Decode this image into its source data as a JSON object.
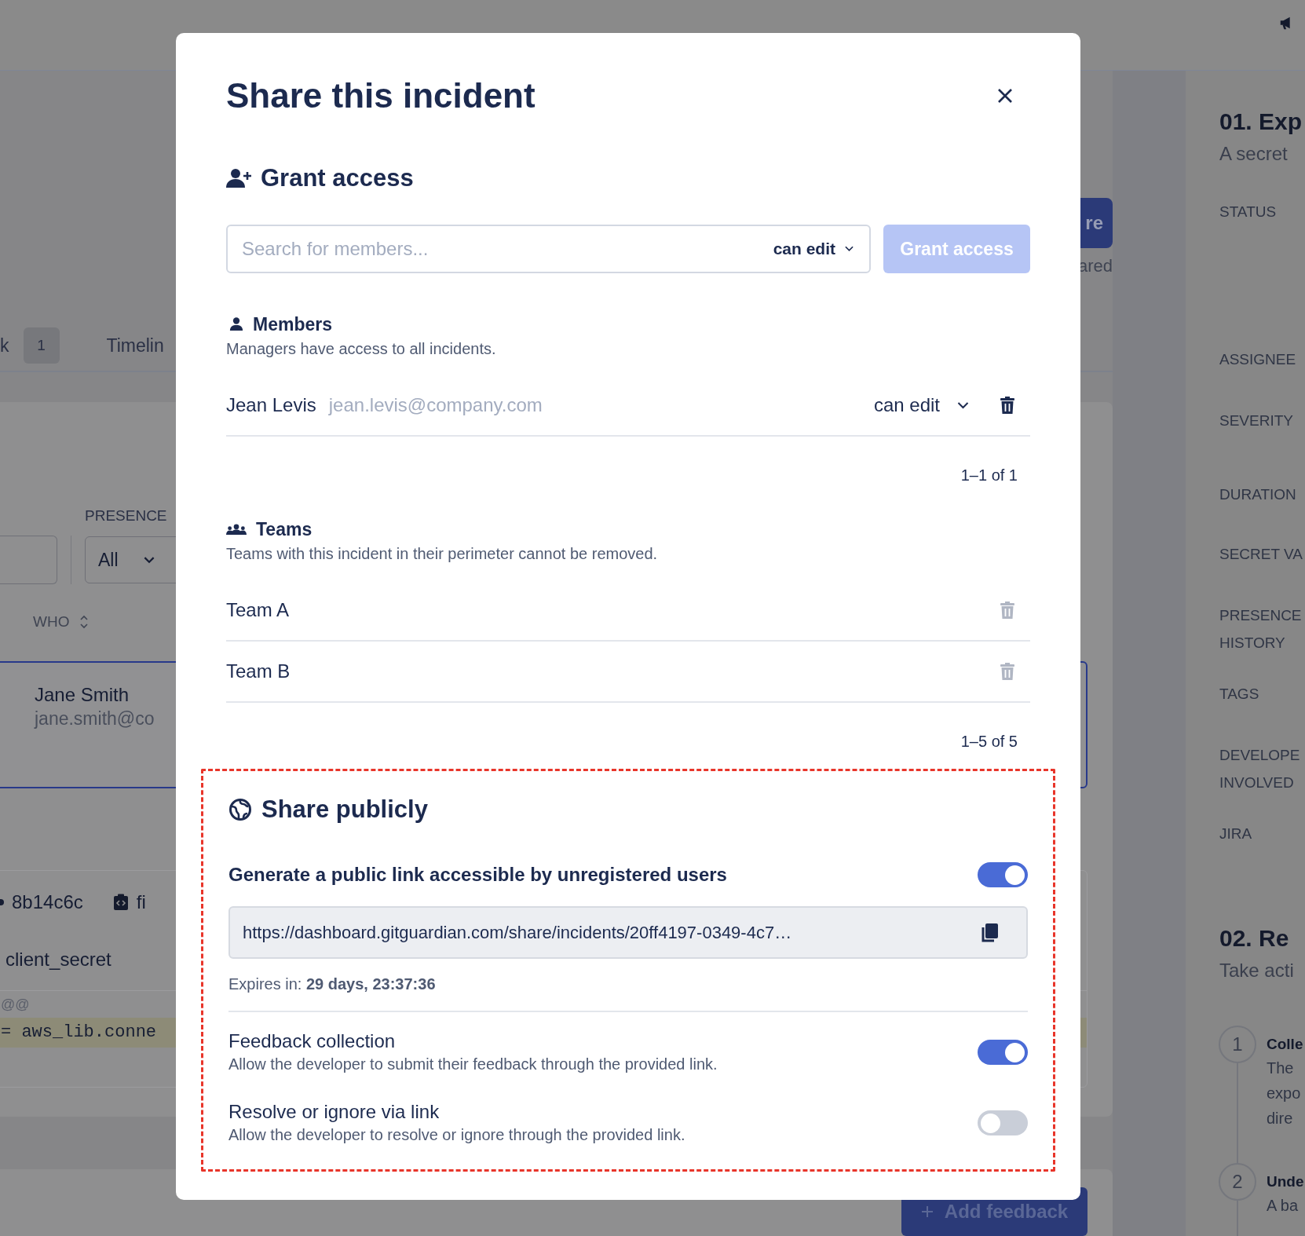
{
  "background": {
    "tabs": [
      {
        "label": "k",
        "count": "1"
      },
      {
        "label": "Timelin"
      }
    ],
    "share_button": "re",
    "share_status": "ared",
    "filter": {
      "label": "PRESENCE",
      "value": "All"
    },
    "table": {
      "column": "WHO",
      "rows": [
        {
          "name": "Jane Smith",
          "email": "jane.smith@co",
          "selected": true
        }
      ]
    },
    "occurrence": {
      "commit": "8b14c6c",
      "file": "fi",
      "secret_name": "client_secret",
      "diff_hunk": "@@",
      "code_line": "= aws_lib.conne"
    },
    "add_feedback_button": "Add feedback",
    "details": {
      "title": "01. Exp",
      "subtitle": "A secret",
      "fields": [
        {
          "lines": [
            "STATUS"
          ]
        },
        {
          "lines": [
            "ASSIGNEE"
          ]
        },
        {
          "lines": [
            "SEVERITY"
          ]
        },
        {
          "lines": [
            "DURATION"
          ]
        },
        {
          "lines": [
            "SECRET VA"
          ]
        },
        {
          "lines": [
            "PRESENCE",
            "HISTORY"
          ]
        },
        {
          "lines": [
            "TAGS"
          ]
        },
        {
          "lines": [
            "DEVELOPE",
            "INVOLVED"
          ]
        },
        {
          "lines": [
            "JIRA"
          ]
        }
      ]
    },
    "remediation": {
      "title": "02. Re",
      "subtitle": "Take acti",
      "steps": [
        {
          "number": "1",
          "title": "Colle",
          "lines": [
            "The",
            "expo",
            "dire"
          ]
        },
        {
          "number": "2",
          "title": "Unde",
          "lines": [
            "A ba"
          ]
        }
      ]
    }
  },
  "modal": {
    "title": "Share this incident",
    "grant_access": {
      "heading": "Grant access",
      "placeholder": "Search for members...",
      "permission": "can edit",
      "button": "Grant access",
      "button_disabled": true
    },
    "members": {
      "heading": "Members",
      "description": "Managers have access to all incidents.",
      "rows": [
        {
          "name": "Jean Levis",
          "email": "jean.levis@company.com",
          "permission": "can edit",
          "removable": true
        }
      ],
      "pagination": "1–1 of 1"
    },
    "teams": {
      "heading": "Teams",
      "description": "Teams with this incident in their perimeter cannot be removed.",
      "rows": [
        {
          "name": "Team A",
          "removable": false
        },
        {
          "name": "Team B",
          "removable": false
        }
      ],
      "pagination": "1–5 of 5"
    },
    "share_publicly": {
      "heading": "Share publicly",
      "public_link": {
        "label": "Generate a public link accessible by unregistered users",
        "on": true,
        "url": "https://dashboard.gitguardian.com/share/incidents/20ff4197-0349-4c7…",
        "expires": "Expires in: **29 days, 23:37:36**"
      },
      "options": [
        {
          "label": "Feedback collection",
          "description": "Allow the developer to submit their feedback through the provided link.",
          "on": true
        },
        {
          "label": "Resolve or ignore via link",
          "description": "Allow the developer to resolve or ignore through the provided link.",
          "on": false
        }
      ]
    }
  }
}
